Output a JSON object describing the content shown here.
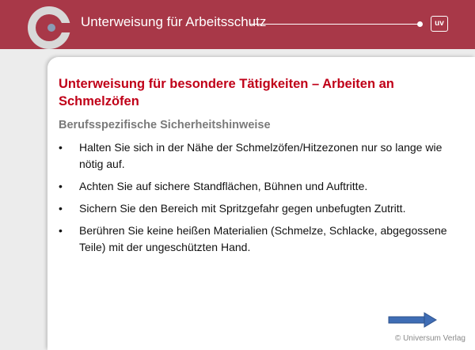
{
  "header": {
    "title": "Unterweisung für Arbeitsschutz",
    "badge": "uv",
    "logo_icon": "circle-logo-icon",
    "color": "#a83848"
  },
  "slide": {
    "title": "Unterweisung für besondere Tätigkeiten – Arbeiten an Schmelzöfen",
    "subtitle": "Berufsspezifische Sicherheitshinweise",
    "bullet_symbol": "•",
    "bullets": [
      "Halten Sie sich in der Nähe der Schmelzöfen/Hitzezonen nur so lange wie nötig auf.",
      "Achten Sie auf sichere Standflächen, Bühnen und Auftritte.",
      "Sichern Sie den Bereich mit Spritzgefahr gegen unbefugten Zutritt.",
      "Berühren Sie keine heißen Materialien (Schmelze, Schlacke, abgegossene Teile) mit der ungeschützten Hand."
    ],
    "title_color": "#c00018",
    "subtitle_color": "#7a7a7a"
  },
  "navigation": {
    "next_icon": "arrow-right-icon",
    "arrow_color": "#3f6db5"
  },
  "footer": {
    "copyright": "© Universum Verlag"
  }
}
